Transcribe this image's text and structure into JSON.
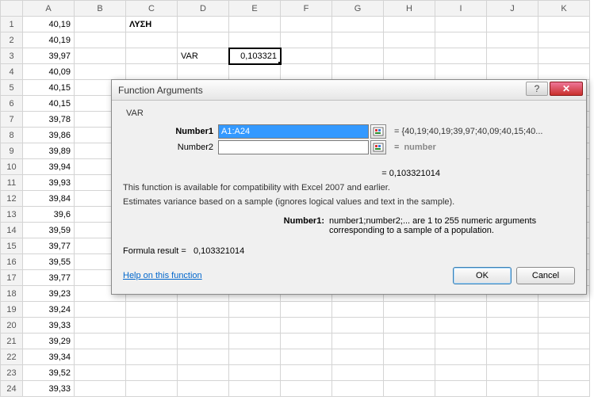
{
  "columns": [
    "A",
    "B",
    "C",
    "D",
    "E",
    "F",
    "G",
    "H",
    "I",
    "J",
    "K"
  ],
  "rows": {
    "1": {
      "A": "40,19",
      "C": "ΛΥΣΗ"
    },
    "2": {
      "A": "40,19"
    },
    "3": {
      "A": "39,97",
      "D": "VAR",
      "E": "0,103321"
    },
    "4": {
      "A": "40,09"
    },
    "5": {
      "A": "40,15"
    },
    "6": {
      "A": "40,15"
    },
    "7": {
      "A": "39,78"
    },
    "8": {
      "A": "39,86"
    },
    "9": {
      "A": "39,89"
    },
    "10": {
      "A": "39,94"
    },
    "11": {
      "A": "39,93"
    },
    "12": {
      "A": "39,84"
    },
    "13": {
      "A": "39,6"
    },
    "14": {
      "A": "39,59"
    },
    "15": {
      "A": "39,77"
    },
    "16": {
      "A": "39,55"
    },
    "17": {
      "A": "39,77"
    },
    "18": {
      "A": "39,23"
    },
    "19": {
      "A": "39,24"
    },
    "20": {
      "A": "39,33"
    },
    "21": {
      "A": "39,29"
    },
    "22": {
      "A": "39,34"
    },
    "23": {
      "A": "39,52"
    },
    "24": {
      "A": "39,33"
    }
  },
  "selected_cell": "E3",
  "dialog": {
    "title": "Function Arguments",
    "fn_name": "VAR",
    "args": {
      "number1": {
        "label": "Number1",
        "value": "A1:A24",
        "preview": "= {40,19;40,19;39,97;40,09;40,15;40..."
      },
      "number2": {
        "label": "Number2",
        "value": "",
        "preview_eq": "=",
        "preview": "number"
      }
    },
    "mid_result": "=   0,103321014",
    "desc_line1": "This function is available for compatibility with Excel 2007 and earlier.",
    "desc_line2": "Estimates variance based on a sample (ignores logical values and text in the sample).",
    "argdesc_label": "Number1:",
    "argdesc_text": "number1;number2;... are 1 to 255 numeric arguments corresponding to a sample of a population.",
    "formula_result_label": "Formula result =",
    "formula_result_value": "0,103321014",
    "help_link": "Help on this function",
    "ok_label": "OK",
    "cancel_label": "Cancel"
  }
}
